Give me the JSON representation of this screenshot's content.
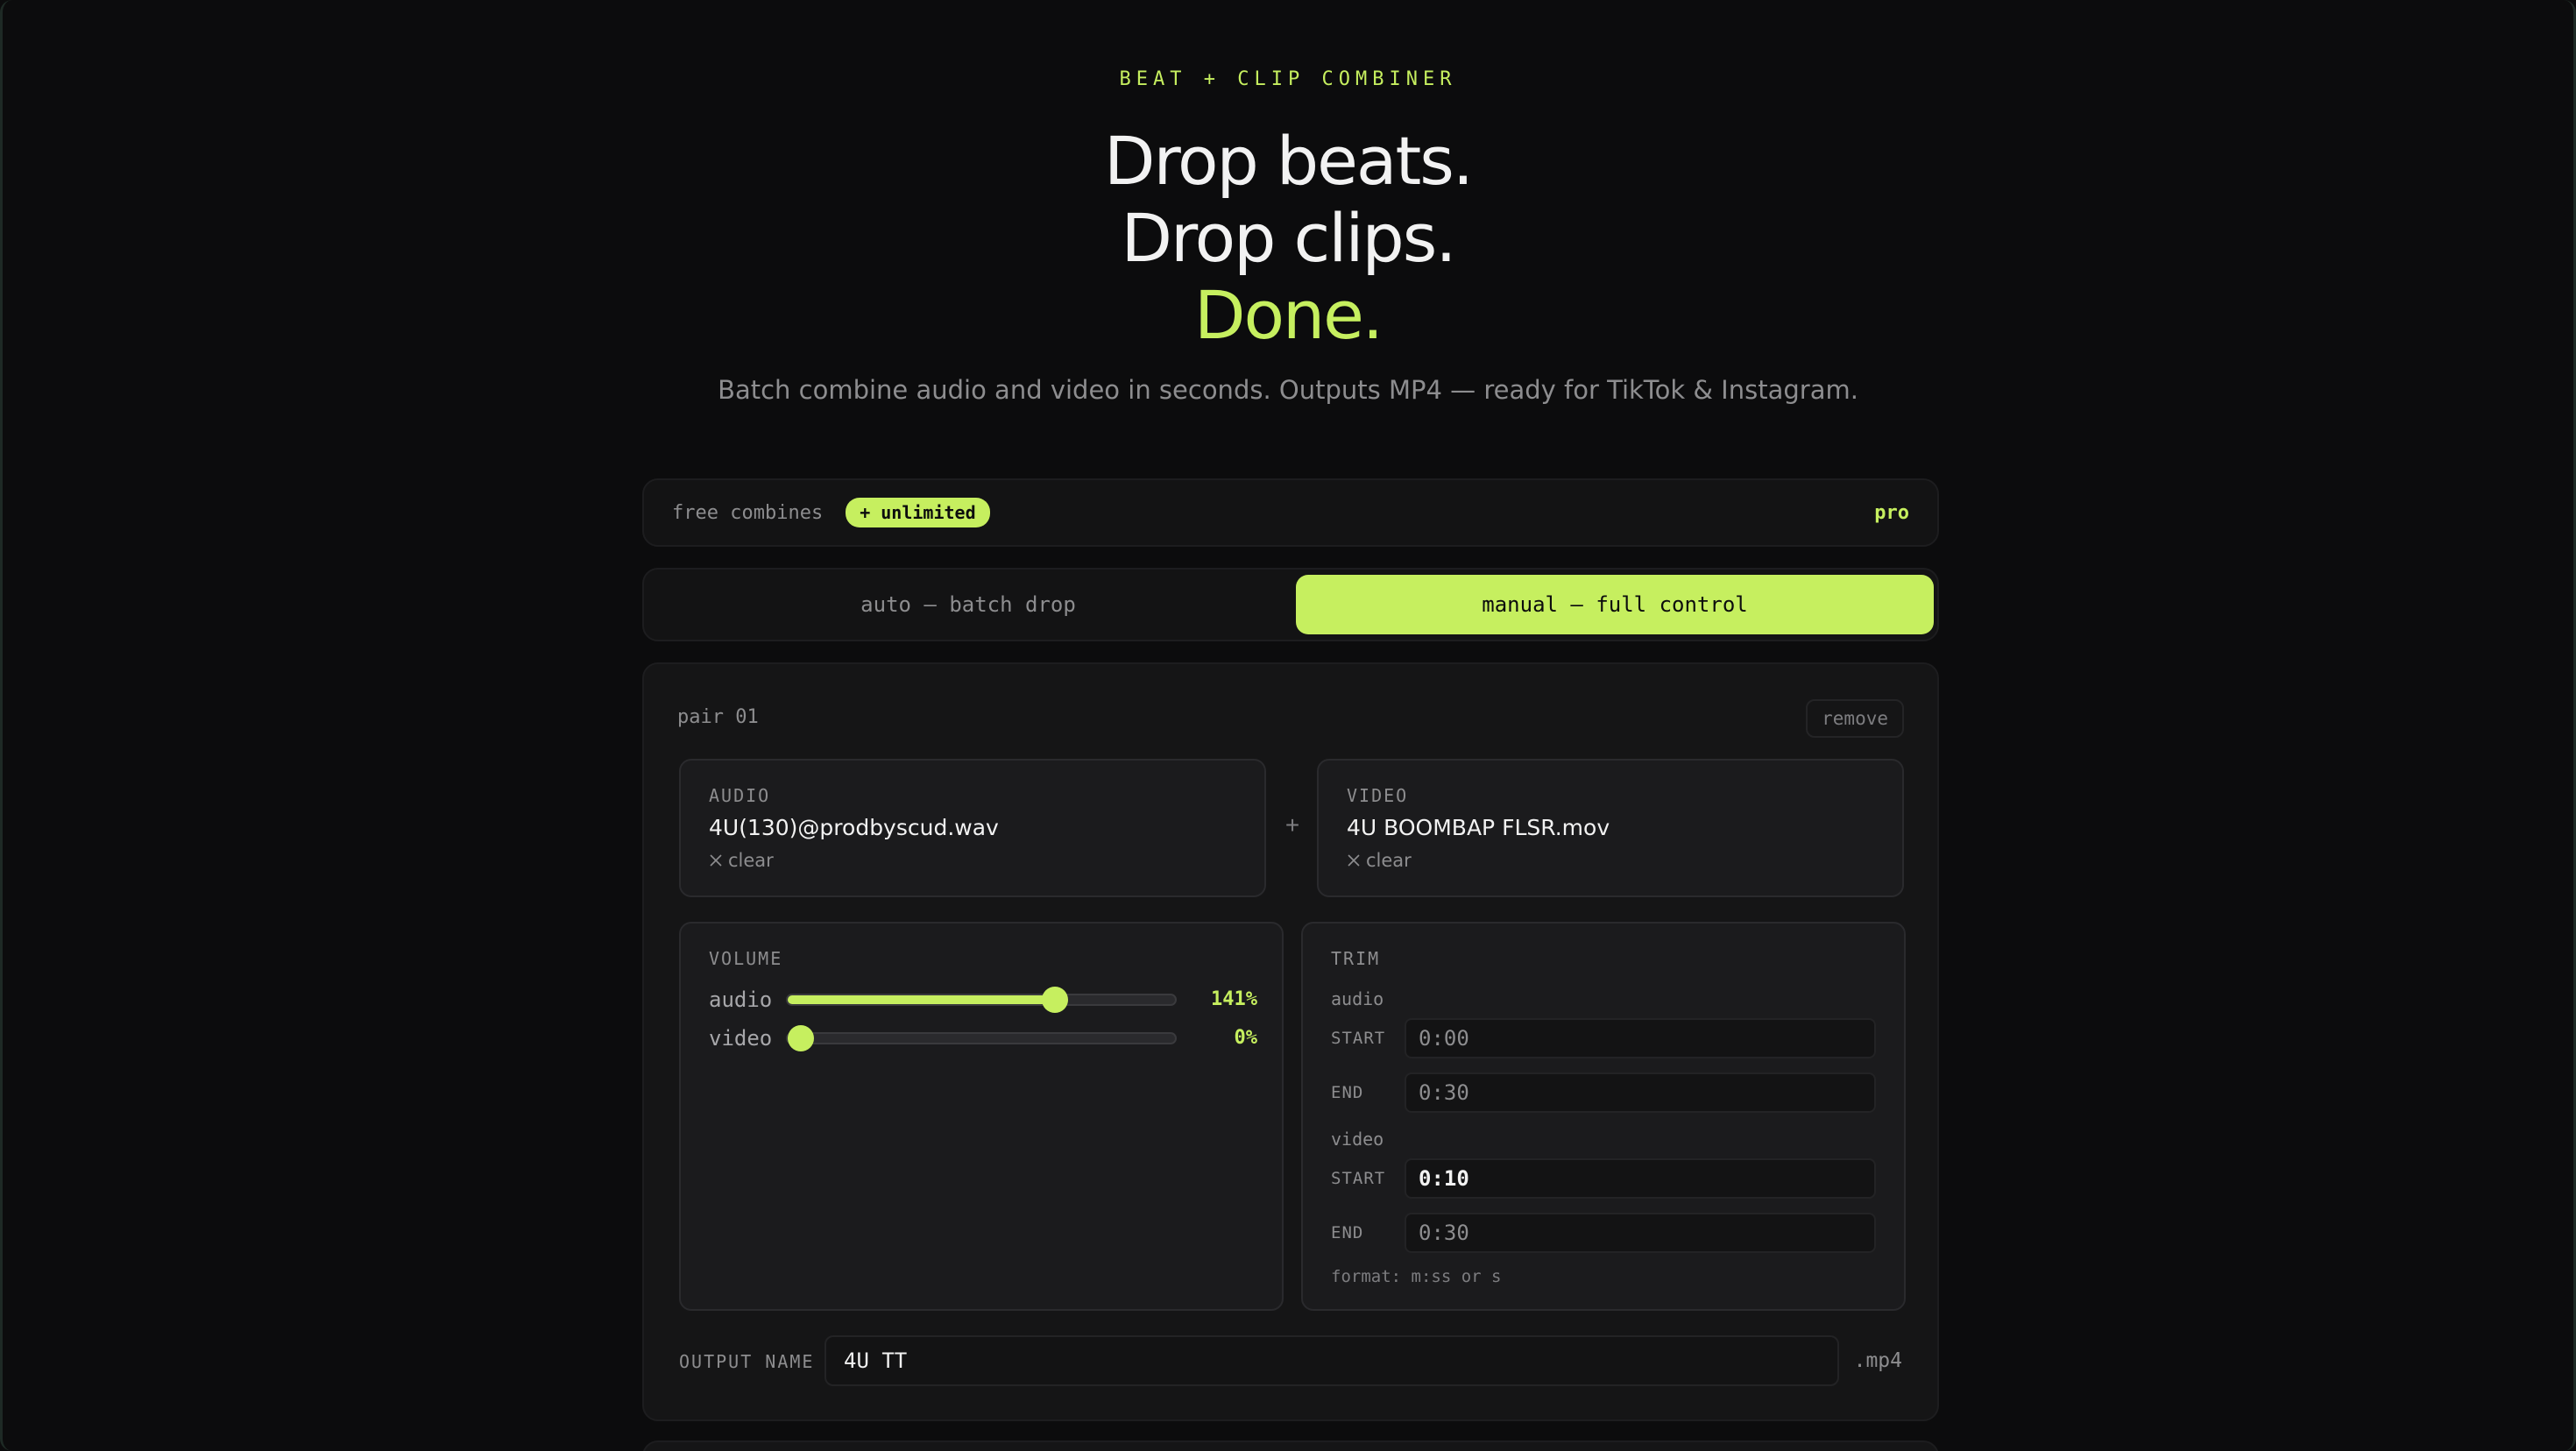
{
  "hero": {
    "eyebrow": "BEAT + CLIP COMBINER",
    "line1": "Drop beats.",
    "line2": "Drop clips.",
    "line3": "Done.",
    "subtitle": "Batch combine audio and video in seconds. Outputs MP4 — ready for TikTok & Instagram."
  },
  "status": {
    "label": "free combines",
    "badge": "+ unlimited",
    "plan": "pro"
  },
  "modes": {
    "auto": "auto — batch drop",
    "manual": "manual — full control",
    "active": "manual"
  },
  "pair": {
    "title": "pair 01",
    "remove_label": "remove",
    "plus": "+",
    "audio": {
      "kind": "AUDIO",
      "name": "4U(130)@prodbyscud.wav",
      "clear": "clear"
    },
    "video": {
      "kind": "VIDEO",
      "name": "4U BOOMBAP FLSR.mov",
      "clear": "clear"
    },
    "volume": {
      "title": "VOLUME",
      "audio": {
        "label": "audio",
        "value": 141,
        "max": 200,
        "display": "141%"
      },
      "video": {
        "label": "video",
        "value": 0,
        "max": 200,
        "display": "0%"
      }
    },
    "trim": {
      "title": "TRIM",
      "audio_label": "audio",
      "video_label": "video",
      "start_label": "START",
      "end_label": "END",
      "audio_start_placeholder": "0:00",
      "audio_end_placeholder": "0:30",
      "video_start_value": "0:10",
      "video_end_placeholder": "0:30",
      "format_note": "format: m:ss or s"
    },
    "output": {
      "label": "OUTPUT NAME",
      "value": "4U TT",
      "extension": ".mp4"
    }
  },
  "colors": {
    "accent": "#c6ef5f",
    "background": "#0c0c0d",
    "card": "#151516"
  }
}
